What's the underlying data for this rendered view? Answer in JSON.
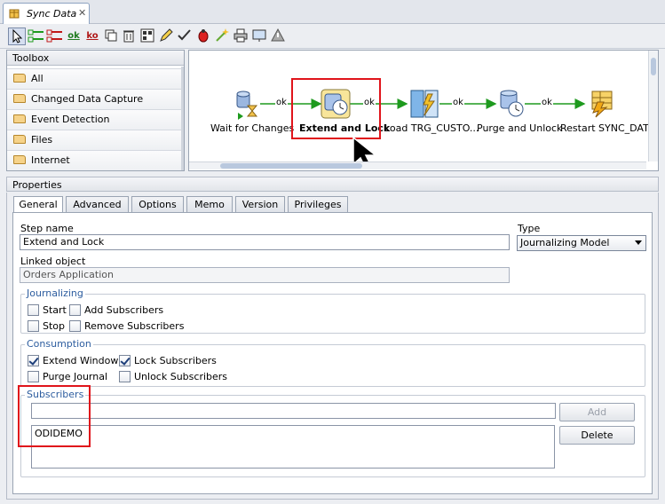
{
  "window": {
    "tab_title": "Sync Data",
    "close": "✕"
  },
  "toolbar": {
    "ok_label": "ok",
    "ko_label": "ko"
  },
  "toolbox": {
    "title": "Toolbox",
    "items": [
      "All",
      "Changed Data Capture",
      "Event Detection",
      "Files",
      "Internet"
    ]
  },
  "diagram": {
    "steps": [
      {
        "label": "Wait for Changes",
        "icon": "wait-for-changes-icon"
      },
      {
        "label": "Extend and Lock",
        "icon": "journalizing-model-icon",
        "selected": true
      },
      {
        "label": "Load TRG_CUSTO...",
        "icon": "interface-icon"
      },
      {
        "label": "Purge and Unlock",
        "icon": "journalizing-model-icon"
      },
      {
        "label": "Restart SYNC_DATA",
        "icon": "start-scenario-icon"
      }
    ],
    "link_label": "ok"
  },
  "properties": {
    "title": "Properties",
    "tabs": [
      "General",
      "Advanced",
      "Options",
      "Memo",
      "Version",
      "Privileges"
    ],
    "active_tab": "General",
    "step_name_label": "Step name",
    "step_name": "Extend and Lock",
    "type_label": "Type",
    "type_value": "Journalizing Model",
    "linked_object_label": "Linked object",
    "linked_object": "Orders Application",
    "journalizing": {
      "title": "Journalizing",
      "start": "Start",
      "add_subscribers": "Add Subscribers",
      "stop": "Stop",
      "remove_subscribers": "Remove Subscribers"
    },
    "consumption": {
      "title": "Consumption",
      "extend_window": "Extend Window",
      "lock_subscribers": "Lock Subscribers",
      "purge_journal": "Purge Journal",
      "unlock_subscribers": "Unlock Subscribers"
    },
    "subscribers": {
      "title": "Subscribers",
      "input_value": "",
      "add": "Add",
      "delete": "Delete",
      "list": [
        "ODIDEMO"
      ]
    }
  },
  "colors": {
    "highlight": "#e0141b",
    "link": "#1e9a1e",
    "group_title": "#2d5d9f"
  }
}
